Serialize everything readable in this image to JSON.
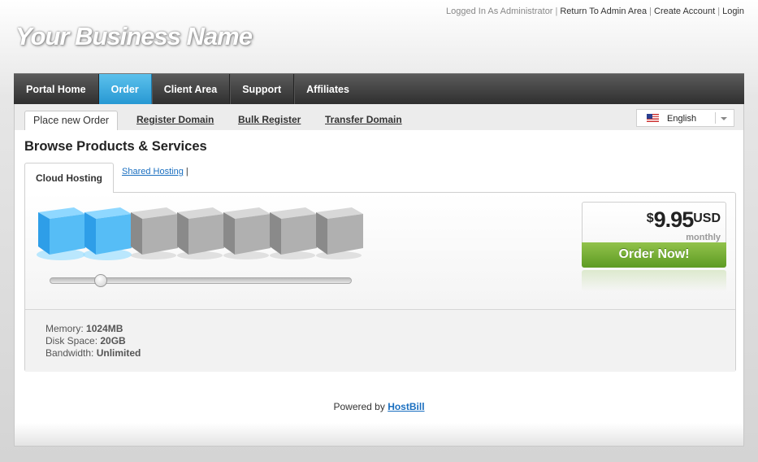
{
  "header": {
    "logged_in_text": "Logged In As Administrator",
    "links": [
      "Return To Admin Area",
      "Create Account",
      "Login"
    ],
    "logo_text": "Your Business Name"
  },
  "nav": {
    "items": [
      "Portal Home",
      "Order",
      "Client Area",
      "Support",
      "Affiliates"
    ],
    "active": "Order",
    "active_color": "#3aa7de"
  },
  "subnav": {
    "tabs": [
      "Place new Order",
      "Register Domain",
      "Bulk Register",
      "Transfer Domain"
    ],
    "active": "Place new Order"
  },
  "language": {
    "selected": "English",
    "flag_icon": "us-flag-icon"
  },
  "main": {
    "title": "Browse Products & Services",
    "categories": [
      "Cloud Hosting",
      "Shared Hosting"
    ],
    "active_category": "Cloud Hosting",
    "category_separator": "|"
  },
  "product": {
    "cubes_total": 7,
    "cubes_selected": 2,
    "slider_position": 0.17,
    "price_currency_symbol": "$",
    "price_amount": "9.95",
    "price_currency": "USD",
    "price_period": "monthly",
    "order_button": "Order Now!",
    "order_button_color": "#7ab03a",
    "specs": [
      {
        "label": "Memory:",
        "value": "1024MB"
      },
      {
        "label": "Disk Space:",
        "value": "20GB"
      },
      {
        "label": "Bandwidth:",
        "value": "Unlimited"
      }
    ]
  },
  "footer": {
    "powered_by": "Powered by",
    "brand": "HostBill"
  }
}
